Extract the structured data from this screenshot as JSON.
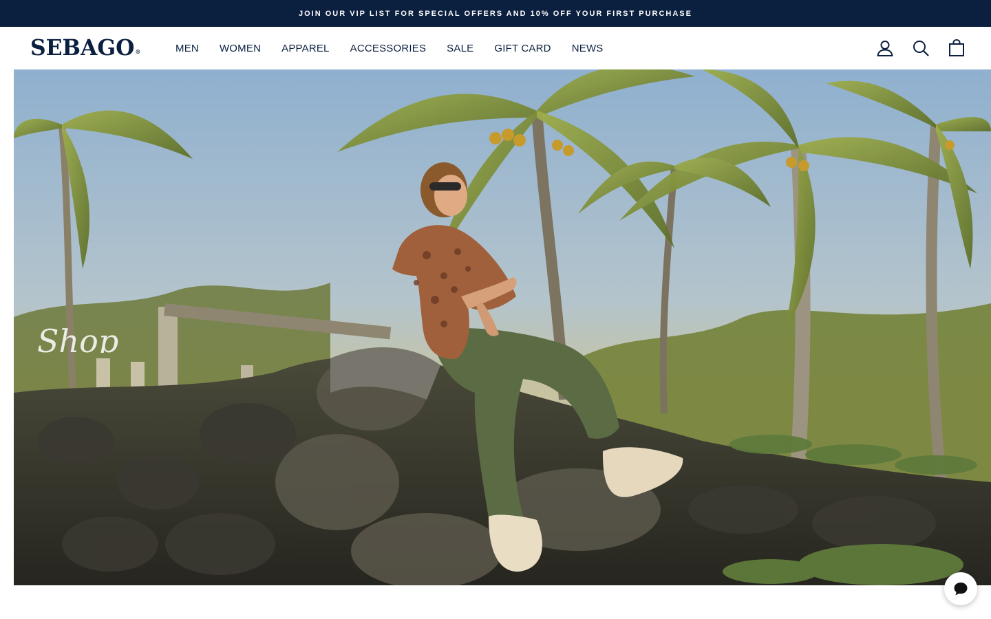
{
  "promo": {
    "text": "JOIN OUR VIP LIST FOR SPECIAL OFFERS AND 10% OFF YOUR FIRST PURCHASE"
  },
  "header": {
    "logo": "SEBAGO",
    "logo_mark": "®",
    "nav": [
      "MEN",
      "WOMEN",
      "APPAREL",
      "ACCESSORIES",
      "SALE",
      "GIFT CARD",
      "NEWS"
    ],
    "icons": [
      "account-icon",
      "search-icon",
      "cart-icon"
    ]
  },
  "hero": {
    "heading": "Shop"
  },
  "chat": {
    "icon": "chat-bubble-icon"
  },
  "colors": {
    "navy": "#0b1f3f",
    "white": "#ffffff"
  }
}
